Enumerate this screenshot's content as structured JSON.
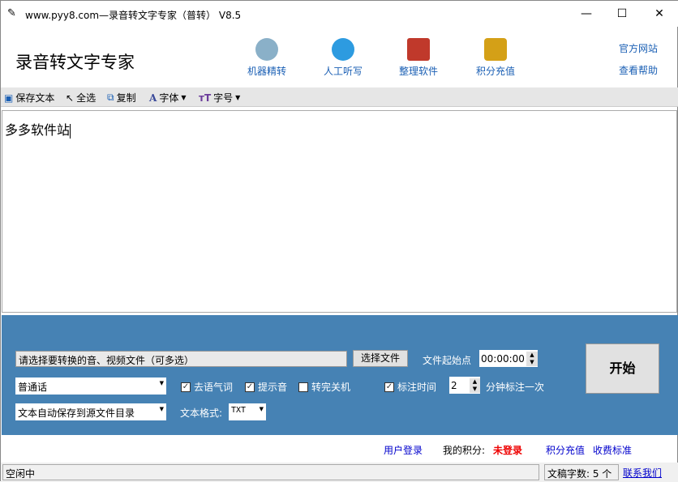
{
  "window": {
    "title": "www.pyy8.com—录音转文字专家（普转） V8.5",
    "minimize": "—",
    "maximize": "☐",
    "close": "✕"
  },
  "header": {
    "app_title": "录音转文字专家",
    "nav": [
      {
        "label": "机器精转",
        "icon": "robot-icon",
        "color": "#8ab0c8"
      },
      {
        "label": "人工听写",
        "icon": "person-icon",
        "color": "#2d9be0"
      },
      {
        "label": "整理软件",
        "icon": "pushpin-icon",
        "color": "#c0392b"
      },
      {
        "label": "积分充值",
        "icon": "coins-icon",
        "color": "#d4a017"
      }
    ],
    "links": {
      "official_site": "官方网站",
      "help": "查看帮助"
    }
  },
  "toolbar": {
    "save": "保存文本",
    "select_all": "全选",
    "copy": "复制",
    "font": "字体",
    "font_size": "字号"
  },
  "editor": {
    "text": "多多软件站"
  },
  "panel": {
    "file_placeholder": "请选择要转换的音、视频文件（可多选）",
    "choose_file": "选择文件",
    "start_point_label": "文件起始点",
    "start_point": "00:00:00",
    "start": "开始",
    "language": "普通话",
    "remove_fillers": "去语气词",
    "beep": "提示音",
    "shutdown": "转完关机",
    "mark_time": "标注时间",
    "mark_interval": "2",
    "mark_suffix": "分钟标注一次",
    "save_location": "文本自动保存到源文件目录",
    "format_label": "文本格式:",
    "format": "TXT",
    "checks": {
      "remove_fillers": true,
      "beep": true,
      "shutdown": false,
      "mark_time": true
    }
  },
  "account": {
    "login": "用户登录",
    "points_label": "我的积分:",
    "points_value": "未登录",
    "recharge": "积分充值",
    "pricing": "收费标准"
  },
  "status": {
    "state": "空闲中",
    "char_count": "文稿字数: 5 个",
    "contact": "联系我们"
  }
}
